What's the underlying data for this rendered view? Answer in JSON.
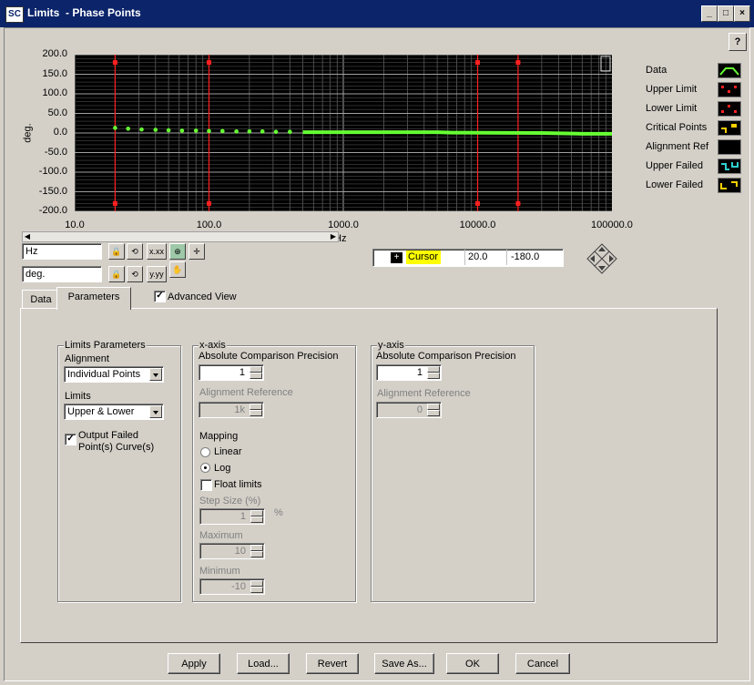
{
  "window": {
    "icon_text": "SC",
    "title": "Limits  - Phase Points",
    "help": "?"
  },
  "plot": {
    "y_ticks": [
      "200.0",
      "150.0",
      "100.0",
      "50.0",
      "0.0",
      "-50.0",
      "-100.0",
      "-150.0",
      "-200.0"
    ],
    "x_ticks": [
      "10.0",
      "100.0",
      "1000.0",
      "10000.0",
      "100000.0"
    ],
    "y_label": "deg.",
    "x_label": "Hz",
    "colors": {
      "data": "#66ff33",
      "limit": "#ff2020",
      "grid": "#808080",
      "background": "#000000"
    }
  },
  "legend": [
    {
      "label": "Data",
      "icon": "data-curve-icon"
    },
    {
      "label": "Upper Limit",
      "icon": "upper-limit-icon"
    },
    {
      "label": "Lower Limit",
      "icon": "lower-limit-icon"
    },
    {
      "label": "Critical Points",
      "icon": "critical-points-icon"
    },
    {
      "label": "Alignment Ref",
      "icon": "alignment-ref-icon"
    },
    {
      "label": "Upper Failed",
      "icon": "upper-failed-icon"
    },
    {
      "label": "Lower Failed",
      "icon": "lower-failed-icon"
    }
  ],
  "scales": {
    "x_unit": "Hz",
    "y_unit": "deg.",
    "x_format": "x.xx",
    "y_format": "y.yy"
  },
  "cursor": {
    "name": "Cursor",
    "x": "20.0",
    "y": "-180.0"
  },
  "tabs": {
    "data": "Data",
    "parameters": "Parameters"
  },
  "advanced_view": "Advanced View",
  "limits_params": {
    "title": "Limits Parameters",
    "alignment_label": "Alignment",
    "alignment_value": "Individual Points",
    "limits_label": "Limits",
    "limits_value": "Upper & Lower",
    "output_failed_line1": "Output Failed",
    "output_failed_line2": "Point(s) Curve(s)"
  },
  "x_axis": {
    "title": "x-axis",
    "acp_label": "Absolute Comparison Precision",
    "acp_value": "1",
    "align_ref_label": "Alignment Reference",
    "align_ref_value": "1k",
    "mapping_label": "Mapping",
    "linear": "Linear",
    "log": "Log",
    "float_limits": "Float limits",
    "step_label": "Step Size (%)",
    "step_value": "1",
    "step_unit": "%",
    "max_label": "Maximum",
    "max_value": "10",
    "min_label": "Minimum",
    "min_value": "-10"
  },
  "y_axis": {
    "title": "y-axis",
    "acp_label": "Absolute Comparison Precision",
    "acp_value": "1",
    "align_ref_label": "Alignment Reference",
    "align_ref_value": "0"
  },
  "buttons": {
    "apply": "Apply",
    "load": "Load...",
    "revert": "Revert",
    "save_as": "Save As...",
    "ok": "OK",
    "cancel": "Cancel"
  }
}
